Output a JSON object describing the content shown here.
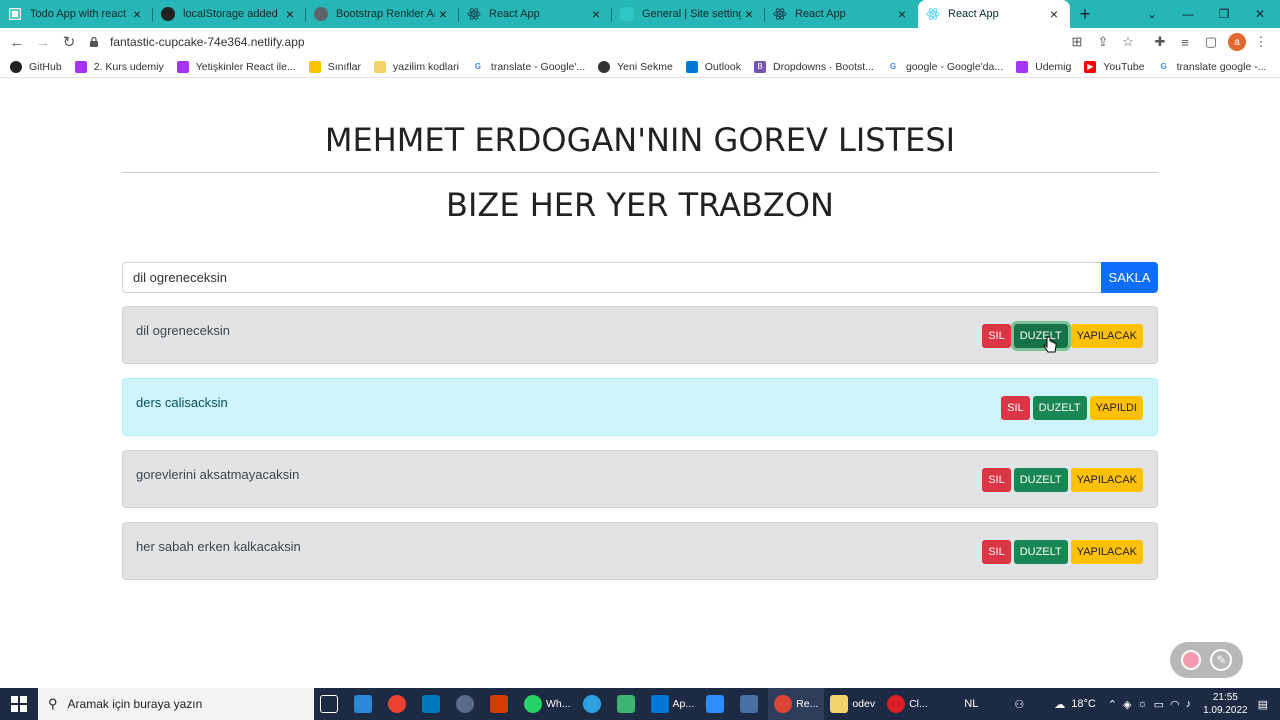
{
  "browser": {
    "tabs": [
      {
        "label": "Todo App with react -",
        "icon": "todo-favicon",
        "color": "#ffffff"
      },
      {
        "label": "localStorage added · er",
        "icon": "github-icon",
        "color": "#ffffff"
      },
      {
        "label": "Bootstrap Renkler Arka",
        "icon": "web-icon",
        "color": "#5f6368"
      },
      {
        "label": "React App",
        "icon": "react-icon",
        "color": "#61dafb"
      },
      {
        "label": "General | Site settings",
        "icon": "netlify-icon",
        "color": "#26b6b5"
      },
      {
        "label": "React App",
        "icon": "react-icon",
        "color": "#61dafb"
      },
      {
        "label": "React App",
        "icon": "react-icon",
        "color": "#61dafb"
      }
    ],
    "url": "fantastic-cupcake-74e364.netlify.app",
    "profile_initial": "a",
    "bookmarks": [
      {
        "label": "GitHub",
        "icon": "github-icon",
        "color": "#222222"
      },
      {
        "label": "2. Kurs udemiy",
        "icon": "udemy-icon",
        "color": "#a435f0"
      },
      {
        "label": "Yetişkinler React ile...",
        "icon": "udemy-icon",
        "color": "#a435f0"
      },
      {
        "label": "Sınıflar",
        "icon": "classroom-icon",
        "color": "#f7c300"
      },
      {
        "label": "yazilim kodlari",
        "icon": "folder-icon",
        "color": "#f3d36b"
      },
      {
        "label": "translate - Google'...",
        "icon": "google-icon",
        "color": "#4285f4"
      },
      {
        "label": "Yeni Sekme",
        "icon": "globe-icon",
        "color": "#333333"
      },
      {
        "label": "Outlook",
        "icon": "outlook-icon",
        "color": "#0078d4"
      },
      {
        "label": "Dropdowns · Bootst...",
        "icon": "bootstrap-icon",
        "color": "#7952b3"
      },
      {
        "label": "google - Google'da...",
        "icon": "google-icon",
        "color": "#4285f4"
      },
      {
        "label": "Udemig",
        "icon": "udemy-icon",
        "color": "#a435f0"
      },
      {
        "label": "YouTube",
        "icon": "youtube-icon",
        "color": "#ff0000"
      },
      {
        "label": "translate google -...",
        "icon": "google-icon",
        "color": "#4285f4"
      }
    ]
  },
  "app": {
    "title": "MEHMET ERDOGAN'NIN GOREV LISTESI",
    "subtitle": "BIZE HER YER TRABZON",
    "input_value": "dil ogreneceksin",
    "save_label": "SAKLA",
    "todos": [
      {
        "text": "dil ogreneceksin",
        "delete_label": "SIL",
        "edit_label": "DUZELT",
        "status_label": "YAPILACAK",
        "done": false
      },
      {
        "text": "ders calisacksin",
        "delete_label": "SIL",
        "edit_label": "DUZELT",
        "status_label": "YAPILDI",
        "done": true
      },
      {
        "text": "gorevlerini aksatmayacaksin",
        "delete_label": "SIL",
        "edit_label": "DUZELT",
        "status_label": "YAPILACAK",
        "done": false
      },
      {
        "text": "her sabah erken kalkacaksin",
        "delete_label": "SIL",
        "edit_label": "DUZELT",
        "status_label": "YAPILACAK",
        "done": false
      }
    ]
  },
  "taskbar": {
    "search_placeholder": "Aramak için buraya yazın",
    "apps": [
      {
        "label": "",
        "icon": "task-view-icon"
      },
      {
        "label": "",
        "icon": "store-icon"
      },
      {
        "label": "",
        "icon": "chrome-colorful-icon"
      },
      {
        "label": "",
        "icon": "trello-icon"
      },
      {
        "label": "",
        "icon": "cloud-icon"
      },
      {
        "label": "",
        "icon": "office-icon"
      },
      {
        "label": "Wh...",
        "icon": "whatsapp-icon"
      },
      {
        "label": "",
        "icon": "telegram-icon"
      },
      {
        "label": "",
        "icon": "git-icon"
      },
      {
        "label": "Ap...",
        "icon": "vscode-icon"
      },
      {
        "label": "",
        "icon": "zoom-icon"
      },
      {
        "label": "",
        "icon": "terminal-icon"
      },
      {
        "label": "Re...",
        "icon": "chrome-icon"
      },
      {
        "label": "odev",
        "icon": "folder-icon"
      },
      {
        "label": "Cl...",
        "icon": "creative-cloud-icon"
      }
    ],
    "lang": "NL",
    "temperature": "18°C",
    "time": "21:55",
    "date": "1.09.2022"
  }
}
